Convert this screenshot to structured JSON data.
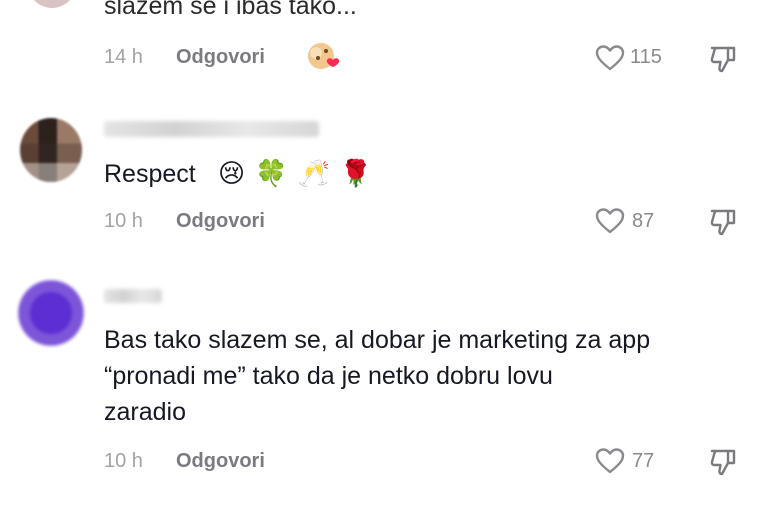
{
  "comments": [
    {
      "text": "slazem se i ibas tako...",
      "time": "14 h",
      "reply_label": "Odgovori",
      "like_count": "115",
      "has_reaction_badge": true
    },
    {
      "text": "Respect",
      "emojis": [
        "😢",
        "🍀",
        "🥂",
        "🌹"
      ],
      "time": "10 h",
      "reply_label": "Odgovori",
      "like_count": "87"
    },
    {
      "text_lines": [
        "Bas tako slazem se, al dobar je marketing za app",
        "“pronadi me” tako da je netko dobru lovu",
        "zaradio"
      ],
      "time": "10 h",
      "reply_label": "Odgovori",
      "like_count": "77"
    }
  ],
  "icons": {
    "like": "heart-outline-icon",
    "dislike": "thumbs-down-icon",
    "reaction": "face-with-heart-badge-icon"
  },
  "colors": {
    "text": "#161823",
    "meta": "#a3a3a7",
    "reply": "#7a7a80",
    "avatar_purple": "#5d2ed3"
  }
}
